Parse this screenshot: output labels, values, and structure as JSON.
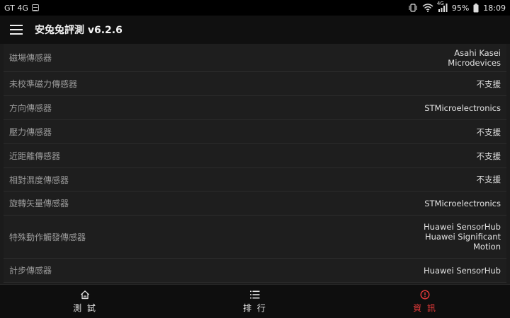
{
  "status_bar": {
    "carrier": "GT 4G",
    "network": "4G",
    "battery": "95%",
    "time": "18:09"
  },
  "app_bar": {
    "title": "安兔兔評測 v6.2.6"
  },
  "sensors": [
    {
      "label": "磁場傳感器",
      "value_lines": [
        "Asahi Kasei",
        "Microdevices"
      ]
    },
    {
      "label": "未校準磁力傳感器",
      "value_lines": [
        "不支援"
      ]
    },
    {
      "label": "方向傳感器",
      "value_lines": [
        "STMicroelectronics"
      ]
    },
    {
      "label": "壓力傳感器",
      "value_lines": [
        "不支援"
      ]
    },
    {
      "label": "近距離傳感器",
      "value_lines": [
        "不支援"
      ]
    },
    {
      "label": "相對濕度傳感器",
      "value_lines": [
        "不支援"
      ]
    },
    {
      "label": "旋轉矢量傳感器",
      "value_lines": [
        "STMicroelectronics"
      ]
    },
    {
      "label": "特殊動作觸發傳感器",
      "value_lines": [
        "Huawei SensorHub",
        "Huawei Significant",
        "Motion"
      ]
    },
    {
      "label": "計步傳感器",
      "value_lines": [
        "Huawei SensorHub"
      ]
    }
  ],
  "bottom_nav": {
    "items": [
      {
        "label": "測 試",
        "icon": "home-icon",
        "active": false
      },
      {
        "label": "排 行",
        "icon": "list-icon",
        "active": false
      },
      {
        "label": "資 訊",
        "icon": "info-icon",
        "active": true
      }
    ],
    "active_color": "#e83a3a"
  }
}
